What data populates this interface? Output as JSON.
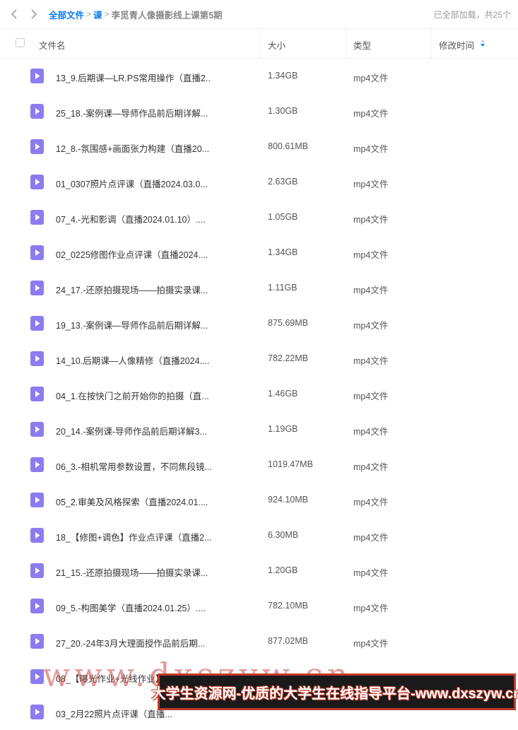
{
  "breadcrumb": {
    "root": "全部文件",
    "parent": "课",
    "current": "李觅青人像摄影线上课第5期",
    "separator": ">"
  },
  "status": "已全部加载，共25个",
  "columns": {
    "name": "文件名",
    "size": "大小",
    "type": "类型",
    "modified": "修改时间"
  },
  "icons": {
    "back": "chevron-left-icon",
    "forward": "chevron-right-icon",
    "file": "video-file-icon",
    "sort": "sort-icon"
  },
  "colors": {
    "accent": "#0a7bf0",
    "video_icon": "#8b7cf0",
    "banner_border": "#c23a2a"
  },
  "files": [
    {
      "name": "13_9.后期课—LR.PS常用操作（直播2...",
      "size": "1.34GB",
      "type": "mp4文件"
    },
    {
      "name": "25_18.-案例课—导师作品前后期详解...",
      "size": "1.30GB",
      "type": "mp4文件"
    },
    {
      "name": "12_8.-氛围感+画面张力构建（直播20...",
      "size": "800.61MB",
      "type": "mp4文件"
    },
    {
      "name": "01_0307照片点评课（直播2024.03.0...",
      "size": "2.63GB",
      "type": "mp4文件"
    },
    {
      "name": "07_4.-光和影调（直播2024.01.10）....",
      "size": "1.05GB",
      "type": "mp4文件"
    },
    {
      "name": "02_0225修图作业点评课（直播2024....",
      "size": "1.34GB",
      "type": "mp4文件"
    },
    {
      "name": "24_17.-还原拍摄现场——拍摄实录课...",
      "size": "1.11GB",
      "type": "mp4文件"
    },
    {
      "name": "19_13.-案例课—导师作品前后期详解...",
      "size": "875.69MB",
      "type": "mp4文件"
    },
    {
      "name": "14_10.后期课—人像精修（直播2024....",
      "size": "782.22MB",
      "type": "mp4文件"
    },
    {
      "name": "04_1.在按快门之前开始你的拍摄（直...",
      "size": "1.46GB",
      "type": "mp4文件"
    },
    {
      "name": "20_14.-案例课-导师作品前后期详解3...",
      "size": "1.19GB",
      "type": "mp4文件"
    },
    {
      "name": "06_3.-相机常用参数设置，不同焦段镜...",
      "size": "1019.47MB",
      "type": "mp4文件"
    },
    {
      "name": "05_2.审美及风格探索（直播2024.01....",
      "size": "924.10MB",
      "type": "mp4文件"
    },
    {
      "name": "18_【修图+调色】作业点评课（直播2...",
      "size": "6.30MB",
      "type": "mp4文件"
    },
    {
      "name": "21_15.-还原拍摄现场——拍摄实录课...",
      "size": "1.20GB",
      "type": "mp4文件"
    },
    {
      "name": "09_5.-构图美学（直播2024.01.25）....",
      "size": "782.10MB",
      "type": "mp4文件"
    },
    {
      "name": "27_20.-24年3月大理面授作品前后期...",
      "size": "877.02MB",
      "type": "mp4文件"
    },
    {
      "name": "08_【曝光作业+光线作业】...",
      "size": "",
      "type": ""
    },
    {
      "name": "03_2月22照片点评课（直播...",
      "size": "",
      "type": ""
    }
  ],
  "watermark": {
    "text": "www.dxszyw.cn",
    "banner": "大学生资源网-优质的大学生在线指导平台-www.dxszyw.cn"
  }
}
